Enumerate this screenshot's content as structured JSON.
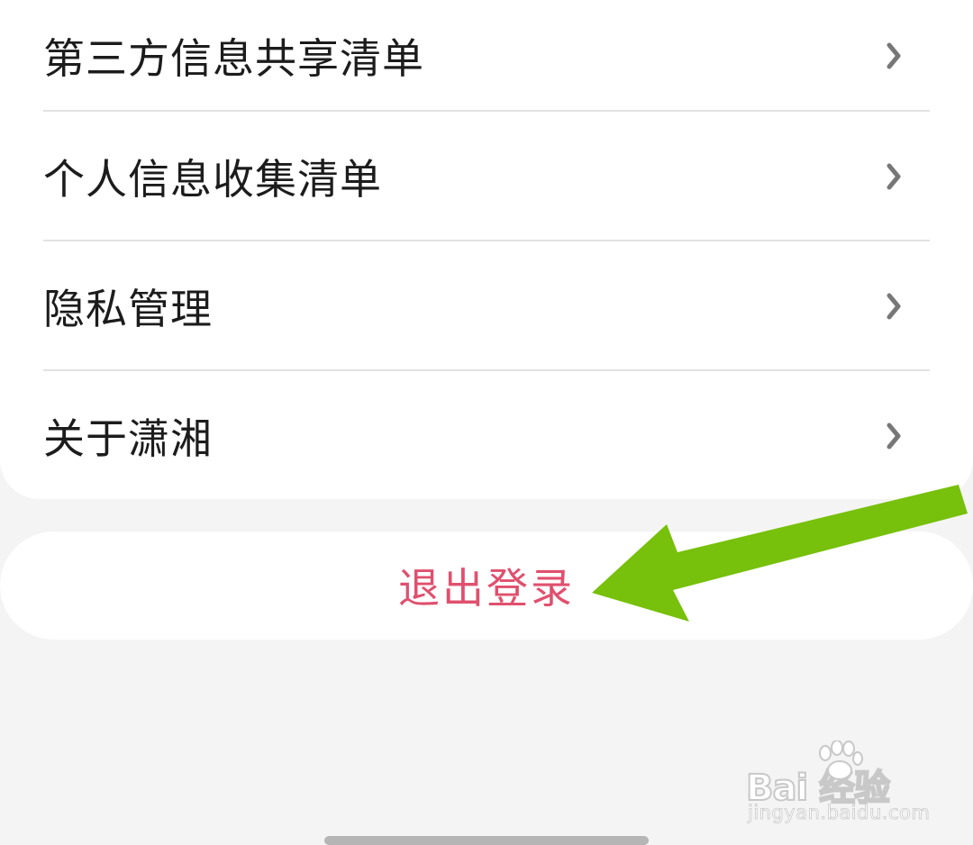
{
  "menu": {
    "items": [
      {
        "label": "第三方信息共享清单"
      },
      {
        "label": "个人信息收集清单"
      },
      {
        "label": "隐私管理"
      },
      {
        "label": "关于潇湘"
      }
    ]
  },
  "logout": {
    "label": "退出登录",
    "color": "#e0506e"
  },
  "icons": {
    "row_chevron": "chevron-right-icon",
    "annotation": "green-arrow-icon"
  },
  "colors": {
    "background": "#f4f4f4",
    "card": "#ffffff",
    "text": "#1c1c1c",
    "chevron": "#777777",
    "arrow": "#77c00b"
  },
  "watermark": {
    "brand": "Bai  经验",
    "url": "jingyan.baidu.com"
  }
}
